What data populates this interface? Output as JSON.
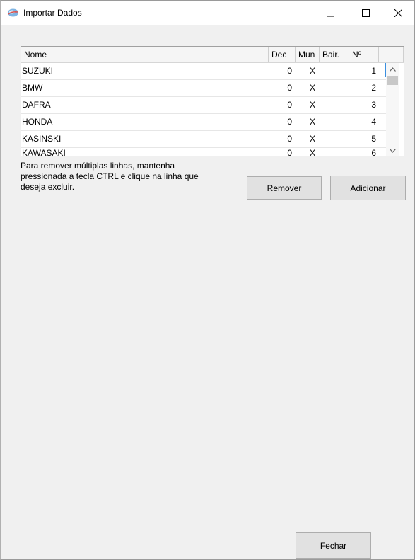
{
  "window": {
    "title": "Importar Dados",
    "icon": "app-globe-icon",
    "controls": [
      "minimize-icon",
      "maximize-icon",
      "close-icon"
    ]
  },
  "grid": {
    "columns": [
      "Nome",
      "Dec",
      "Mun",
      "Bair.",
      "Nº",
      ""
    ],
    "rows": [
      {
        "nome": "SUZUKI",
        "dec": "0",
        "mun": "X",
        "bair": "",
        "num": "1"
      },
      {
        "nome": "BMW",
        "dec": "0",
        "mun": "X",
        "bair": "",
        "num": "2"
      },
      {
        "nome": "DAFRA",
        "dec": "0",
        "mun": "X",
        "bair": "",
        "num": "3"
      },
      {
        "nome": "HONDA",
        "dec": "0",
        "mun": "X",
        "bair": "",
        "num": "4"
      },
      {
        "nome": "KASINSKI",
        "dec": "0",
        "mun": "X",
        "bair": "",
        "num": "5"
      },
      {
        "nome": "KAWASAKI",
        "dec": "0",
        "mun": "X",
        "bair": "",
        "num": "6"
      }
    ]
  },
  "hint_text": "Para remover múltiplas linhas, mantenha pressionada a tecla CTRL e clique na linha que deseja excluir.",
  "buttons": {
    "remover": "Remover",
    "adicionar": "Adicionar",
    "fechar": "Fechar"
  },
  "colors": {
    "window_bg": "#f0f0f0",
    "button_bg": "#e1e1e1",
    "button_border": "#adadad",
    "focus_accent": "#3a8fe0"
  }
}
